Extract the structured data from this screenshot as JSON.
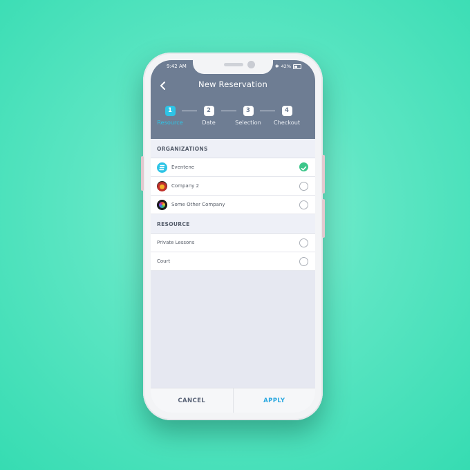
{
  "status": {
    "time": "9:42 AM",
    "battery": "42%"
  },
  "header": {
    "title": "New Reservation"
  },
  "steps": [
    {
      "num": "1",
      "label": "Resource"
    },
    {
      "num": "2",
      "label": "Date"
    },
    {
      "num": "3",
      "label": "Selection"
    },
    {
      "num": "4",
      "label": "Checkout"
    }
  ],
  "organizations": {
    "heading": "ORGANIZATIONS",
    "items": [
      {
        "label": "Eventene",
        "selected": true
      },
      {
        "label": "Company 2",
        "selected": false
      },
      {
        "label": "Some Other Company",
        "selected": false
      }
    ]
  },
  "resource": {
    "heading": "RESOURCE",
    "items": [
      {
        "label": "Private Lessons",
        "selected": false
      },
      {
        "label": "Court",
        "selected": false
      }
    ]
  },
  "footer": {
    "cancel_label": "CANCEL",
    "apply_label": "APPLY"
  },
  "colors": {
    "accent": "#2ec4e6",
    "header_bg": "#6e7d93",
    "check": "#3cc68a",
    "apply": "#2aa8e0"
  }
}
